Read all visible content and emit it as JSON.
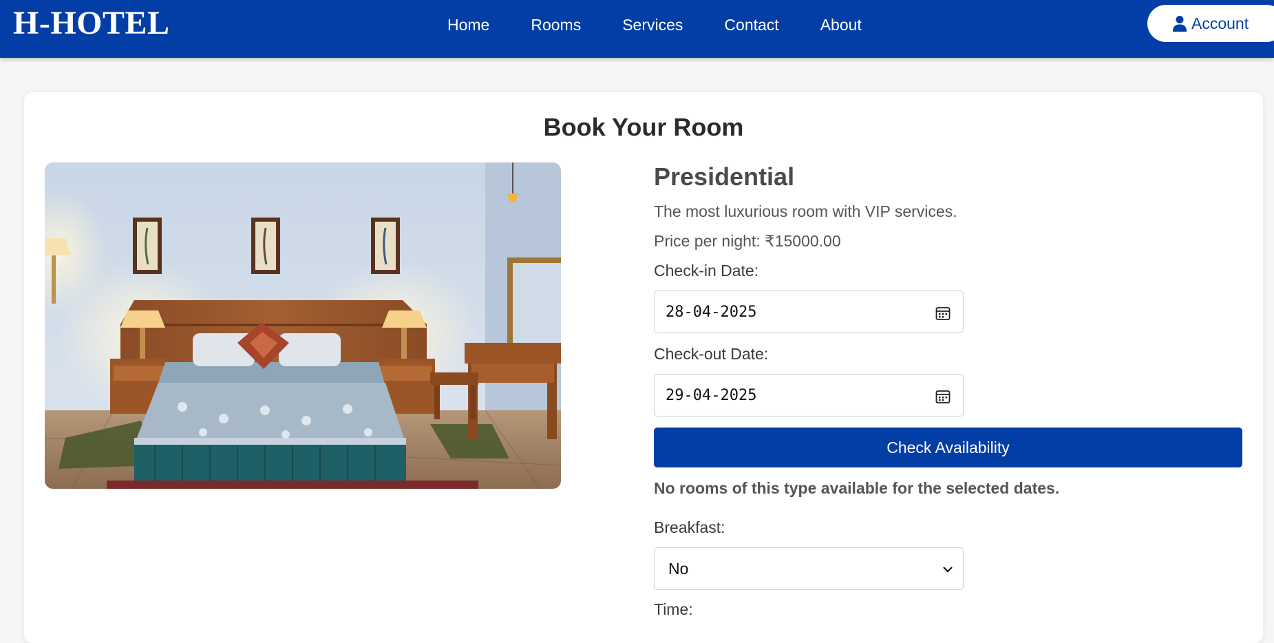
{
  "navbar": {
    "brand": "H-HOTEL",
    "links": [
      "Home",
      "Rooms",
      "Services",
      "Contact",
      "About"
    ],
    "account_label": "Account",
    "account_icon": "user-icon",
    "bg_color": "#023ea6"
  },
  "page": {
    "title": "Book Your Room"
  },
  "room": {
    "name": "Presidential",
    "description": "The most luxurious room with VIP services.",
    "price_line": "Price per night: ₹15000.00"
  },
  "form": {
    "checkin_label": "Check-in Date:",
    "checkin_value": "28-04-2025",
    "checkout_label": "Check-out Date:",
    "checkout_value": "29-04-2025",
    "check_button": "Check Availability",
    "availability_message": "No rooms of this type available for the selected dates.",
    "breakfast_label": "Breakfast:",
    "breakfast_value": "No",
    "time_label": "Time:"
  }
}
